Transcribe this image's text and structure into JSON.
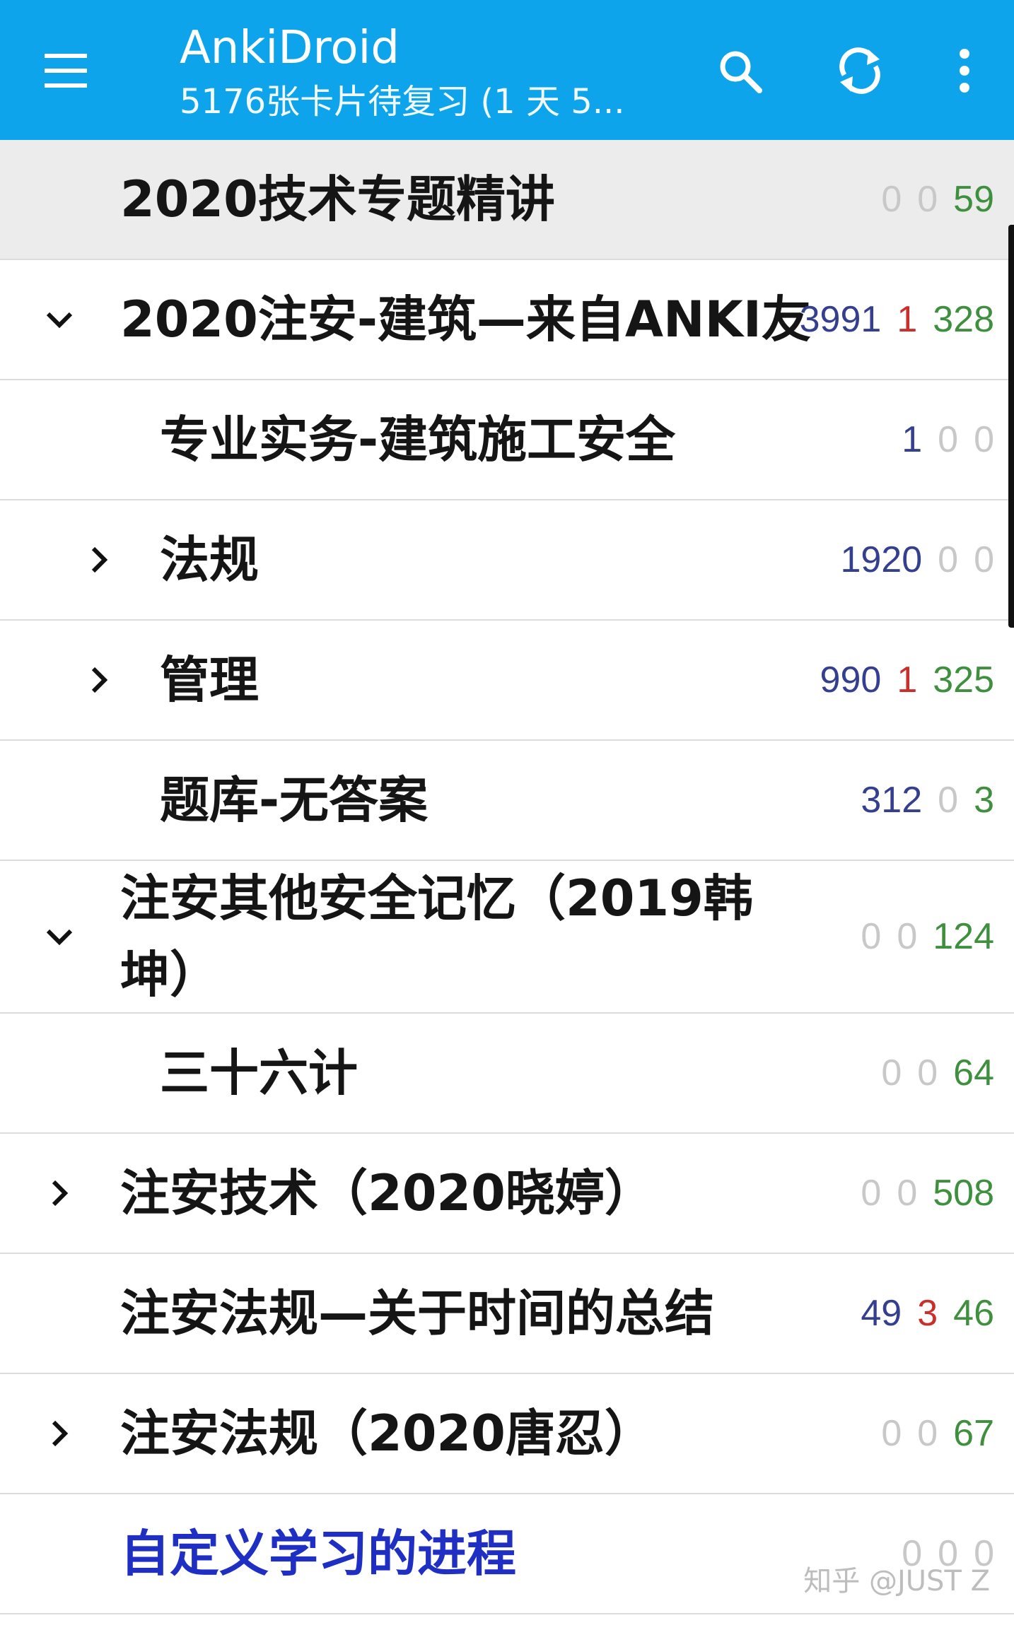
{
  "app_bar": {
    "title": "AnkiDroid",
    "subtitle": "5176张卡片待复习 (1 天 5...",
    "icons": {
      "menu": "menu-icon",
      "search": "search-icon",
      "sync": "sync-icon",
      "overflow": "more-vert-icon"
    }
  },
  "decks": [
    {
      "name": "2020技术专题精讲",
      "expander": "none",
      "selected": true,
      "counts": {
        "new": "0",
        "learn": "0",
        "review": "59"
      }
    },
    {
      "name": "2020注安-建筑—来自ANKI友",
      "expander": "expanded",
      "counts": {
        "new": "3991",
        "learn": "1",
        "review": "328"
      }
    },
    {
      "name": "专业实务-建筑施工安全",
      "expander": "none",
      "counts": {
        "new": "1",
        "learn": "0",
        "review": "0"
      }
    },
    {
      "name": "法规",
      "expander": "collapsed",
      "counts": {
        "new": "1920",
        "learn": "0",
        "review": "0"
      }
    },
    {
      "name": "管理",
      "expander": "collapsed",
      "counts": {
        "new": "990",
        "learn": "1",
        "review": "325"
      }
    },
    {
      "name": "题库-无答案",
      "expander": "none",
      "counts": {
        "new": "312",
        "learn": "0",
        "review": "3"
      }
    },
    {
      "name": "注安其他安全记忆（2019韩坤）",
      "expander": "expanded",
      "counts": {
        "new": "0",
        "learn": "0",
        "review": "124"
      }
    },
    {
      "name": "三十六计",
      "expander": "none",
      "counts": {
        "new": "0",
        "learn": "0",
        "review": "64"
      }
    },
    {
      "name": "注安技术（2020晓婷）",
      "expander": "collapsed",
      "counts": {
        "new": "0",
        "learn": "0",
        "review": "508"
      }
    },
    {
      "name": "注安法规—关于时间的总结",
      "expander": "none",
      "counts": {
        "new": "49",
        "learn": "3",
        "review": "46"
      }
    },
    {
      "name": "注安法规（2020唐忍）",
      "expander": "collapsed",
      "counts": {
        "new": "0",
        "learn": "0",
        "review": "67"
      }
    },
    {
      "name": "自定义学习的进程",
      "expander": "none",
      "filtered": true,
      "counts": {
        "new": "0",
        "learn": "0",
        "review": "0"
      }
    }
  ],
  "watermark": "知乎 @JUST Z",
  "colors": {
    "app_bar": "#0ea4ec",
    "new_count": "#34408f",
    "learn_count": "#c9302c",
    "review_count": "#3e8f3e",
    "zero_count": "#c8c8c8",
    "filtered_deck": "#1f2fc4",
    "selected_row": "#ececec"
  }
}
